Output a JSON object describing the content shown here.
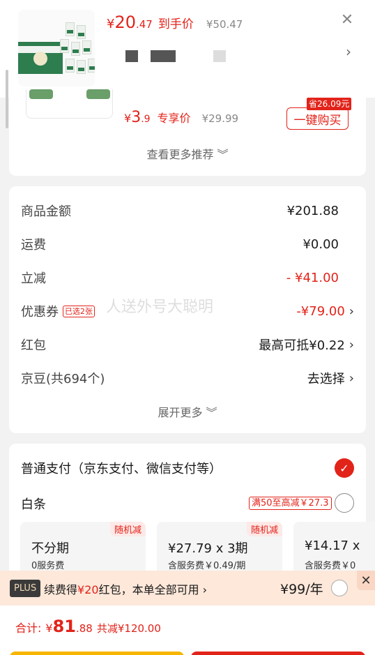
{
  "product": {
    "price_int": "20",
    "price_dec": ".47",
    "price_tag": "到手价",
    "orig_price": "¥50.47",
    "currency": "¥",
    "close_icon": "close-icon"
  },
  "recommend": {
    "price_int": "3",
    "price_dec": ".9",
    "price_tag": "专享价",
    "orig_price": "¥29.99",
    "save_badge": "省26.09元",
    "buy_label": "一键购买",
    "more_label": "查看更多推荐"
  },
  "amounts": {
    "goods_label": "商品金额",
    "goods_value": "¥201.88",
    "shipping_label": "运费",
    "shipping_value": "¥0.00",
    "discount_label": "立减",
    "discount_value": "- ¥41.00",
    "coupon_label": "优惠券",
    "coupon_tag": "已选2张",
    "coupon_value": "-¥79.00",
    "redpacket_label": "红包",
    "redpacket_value": "最高可抵¥0.22",
    "jingdou_label": "京豆(共694个)",
    "jingdou_value": "去选择",
    "expand_label": "展开更多",
    "watermark": "人送外号大聪明"
  },
  "payment": {
    "normal_label": "普通支付（京东支付、微信支付等）",
    "baitiao_label": "白条",
    "baitiao_promo": "满50至高减￥27.3",
    "plans": [
      {
        "badge": "随机减",
        "title": "不分期",
        "sub": "0服务费"
      },
      {
        "badge": "随机减",
        "title": "¥27.79 x 3期",
        "sub": "含服务费￥0.49/期"
      },
      {
        "badge": "",
        "title": "¥14.17 x",
        "sub": "含服务费￥0"
      }
    ]
  },
  "plus": {
    "logo": "PLUS",
    "text_pre": "续费得",
    "text_amount": "¥20",
    "text_post": "红包，本单全部可用",
    "price": "¥99/年"
  },
  "total": {
    "label": "合计:",
    "currency": "¥",
    "int": "81",
    "dec": ".88",
    "saved": "共减¥120.00"
  },
  "colors": {
    "accent": "#e2231a",
    "gold": "#f7b500"
  }
}
